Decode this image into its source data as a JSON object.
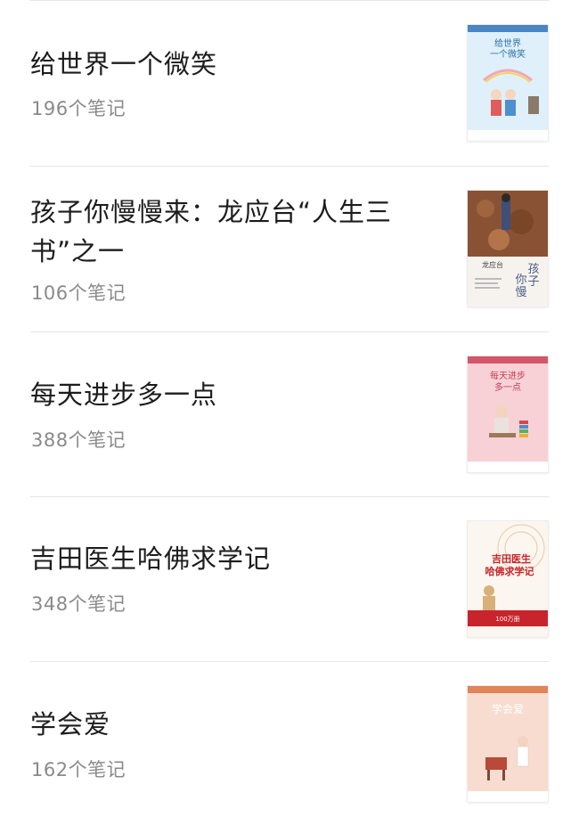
{
  "books": [
    {
      "title": "给世界一个微笑",
      "notes": "196个笔记",
      "cover": {
        "title": "给世界\n一个微笑",
        "bg": "#d9ecf7",
        "accent": "#3b7fb8"
      }
    },
    {
      "title": "孩子你慢慢来：龙应台“人生三书”之一",
      "notes": "106个笔记",
      "cover": {
        "title": "孩子你慢慢来",
        "author": "龙应台",
        "bg": "#f4f1ec",
        "accent": "#5a6a8a"
      }
    },
    {
      "title": "每天进步多一点",
      "notes": "388个笔记",
      "cover": {
        "title": "每天进步\n多一点",
        "bg": "#f6c9cf",
        "accent": "#c94b5c"
      }
    },
    {
      "title": "吉田医生哈佛求学记",
      "notes": "348个笔记",
      "cover": {
        "title": "吉田医生\n哈佛求学记",
        "bg": "#fbf5ee",
        "accent": "#c8242b"
      }
    },
    {
      "title": "学会爱",
      "notes": "162个笔记",
      "cover": {
        "title": "学会爱",
        "bg": "#f6d6c8",
        "accent": "#e07a4f"
      }
    }
  ]
}
